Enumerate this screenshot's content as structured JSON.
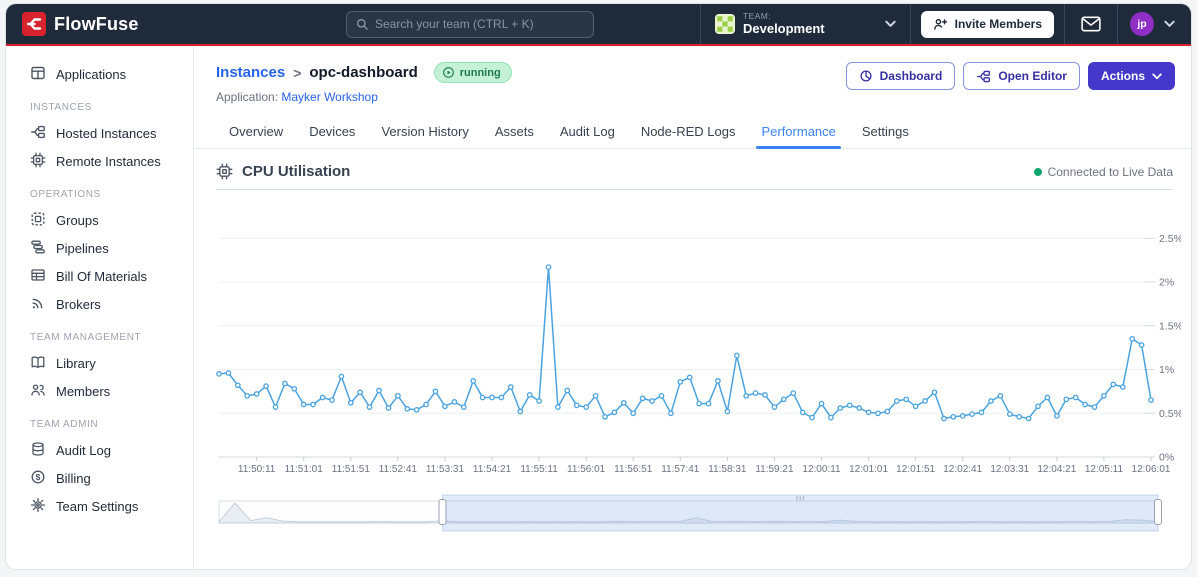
{
  "navbar": {
    "logo_text": "FlowFuse",
    "search_placeholder": "Search your team (CTRL + K)",
    "team_label": "TEAM:",
    "team_name": "Development",
    "invite_button": "Invite Members",
    "avatar_initials": "jp"
  },
  "sidebar": {
    "sections": [
      {
        "title": "",
        "items": [
          {
            "label": "Applications"
          }
        ]
      },
      {
        "title": "INSTANCES",
        "items": [
          {
            "label": "Hosted Instances"
          },
          {
            "label": "Remote Instances"
          }
        ]
      },
      {
        "title": "OPERATIONS",
        "items": [
          {
            "label": "Groups"
          },
          {
            "label": "Pipelines"
          },
          {
            "label": "Bill Of Materials"
          },
          {
            "label": "Brokers"
          }
        ]
      },
      {
        "title": "TEAM MANAGEMENT",
        "items": [
          {
            "label": "Library"
          },
          {
            "label": "Members"
          }
        ]
      },
      {
        "title": "TEAM ADMIN",
        "items": [
          {
            "label": "Audit Log"
          },
          {
            "label": "Billing"
          },
          {
            "label": "Team Settings"
          }
        ]
      }
    ]
  },
  "header": {
    "breadcrumb_root": "Instances",
    "breadcrumb_separator": ">",
    "instance_name": "opc-dashboard",
    "status_badge": "running",
    "application_label": "Application:",
    "application_name": "Mayker Workshop",
    "buttons": {
      "dashboard": "Dashboard",
      "open_editor": "Open Editor",
      "actions": "Actions"
    }
  },
  "tabs": {
    "items": [
      "Overview",
      "Devices",
      "Version History",
      "Assets",
      "Audit Log",
      "Node-RED Logs",
      "Performance",
      "Settings"
    ],
    "active": "Performance"
  },
  "chart": {
    "title": "CPU Utilisation",
    "status": "Connected to Live Data"
  },
  "chart_data": {
    "type": "line",
    "title": "CPU Utilisation",
    "unit": "%",
    "grid": true,
    "line_color": "#4aa3e0",
    "ylim": [
      0,
      2.75
    ],
    "y_tick_labels": [
      "0%",
      "0.5%",
      "1%",
      "1.5%",
      "2%",
      "2.5%"
    ],
    "y_tick_values": [
      0,
      0.5,
      1,
      1.5,
      2,
      2.5
    ],
    "x_tick_labels": [
      "11:50:11",
      "11:51:01",
      "11:51:51",
      "11:52:41",
      "11:53:31",
      "11:54:21",
      "11:55:11",
      "11:56:01",
      "11:56:51",
      "11:57:41",
      "11:58:31",
      "11:59:21",
      "12:00:11",
      "12:01:01",
      "12:01:51",
      "12:02:41",
      "12:03:31",
      "12:04:21",
      "12:05:11",
      "12:06:01"
    ],
    "x_start_time": "11:49:31",
    "x_interval_seconds": 10,
    "values": [
      0.95,
      0.96,
      0.82,
      0.7,
      0.72,
      0.81,
      0.57,
      0.84,
      0.78,
      0.6,
      0.6,
      0.68,
      0.65,
      0.92,
      0.62,
      0.74,
      0.57,
      0.76,
      0.56,
      0.7,
      0.55,
      0.54,
      0.6,
      0.75,
      0.58,
      0.63,
      0.57,
      0.87,
      0.68,
      0.68,
      0.68,
      0.8,
      0.52,
      0.71,
      0.64,
      2.17,
      0.57,
      0.76,
      0.59,
      0.57,
      0.7,
      0.46,
      0.51,
      0.62,
      0.5,
      0.67,
      0.64,
      0.7,
      0.5,
      0.86,
      0.91,
      0.61,
      0.61,
      0.87,
      0.52,
      1.16,
      0.7,
      0.73,
      0.71,
      0.57,
      0.66,
      0.73,
      0.51,
      0.45,
      0.61,
      0.45,
      0.56,
      0.59,
      0.56,
      0.51,
      0.5,
      0.52,
      0.64,
      0.66,
      0.58,
      0.64,
      0.74,
      0.44,
      0.46,
      0.47,
      0.49,
      0.51,
      0.64,
      0.7,
      0.49,
      0.46,
      0.44,
      0.58,
      0.68,
      0.47,
      0.66,
      0.68,
      0.6,
      0.57,
      0.7,
      0.83,
      0.8,
      1.35,
      1.28,
      0.65
    ],
    "overview": {
      "values": [
        0.5,
        8.5,
        1.0,
        2.2,
        0.8,
        0.55,
        0.5,
        0.55,
        0.5,
        0.55,
        0.6,
        0.5,
        0.55,
        0.5,
        0.9,
        0.55,
        0.5,
        0.55,
        0.5,
        0.6,
        0.55,
        0.5,
        0.6,
        0.55,
        0.5,
        0.7,
        0.6,
        0.65,
        0.6,
        0.7,
        2.17,
        0.6,
        0.7,
        0.65,
        0.6,
        0.7,
        0.6,
        0.65,
        0.6,
        1.16,
        0.7,
        0.6,
        0.55,
        0.6,
        0.55,
        0.6,
        0.55,
        0.6,
        0.65,
        0.6,
        0.55,
        0.6,
        0.55,
        0.6,
        0.65,
        0.6,
        0.7,
        1.35,
        1.2,
        0.6
      ],
      "selection": [
        0.238,
        1.0
      ]
    }
  },
  "colors": {
    "navbar_bg": "#1f2a3a",
    "brand_red": "#d6232e",
    "primary_indigo": "#4338ca",
    "link_blue": "#2563eb",
    "active_tab_blue": "#3b82f6",
    "chart_line_blue": "#4aa3e0",
    "live_dot_green": "#10a46c",
    "badge_bg_green": "#c5f1d6",
    "badge_text_green": "#1b7a4b"
  }
}
